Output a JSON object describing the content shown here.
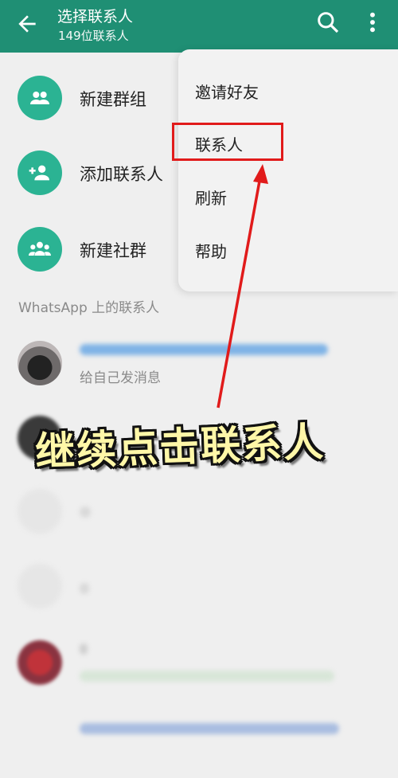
{
  "header": {
    "title": "选择联系人",
    "subtitle": "149位联系人"
  },
  "actions": [
    {
      "label": "新建群组",
      "icon": "group-icon"
    },
    {
      "label": "添加联系人",
      "icon": "add-person-icon"
    },
    {
      "label": "新建社群",
      "icon": "community-icon"
    }
  ],
  "section": {
    "label": "WhatsApp 上的联系人"
  },
  "contacts": [
    {
      "status": "给自己发消息"
    }
  ],
  "menu": {
    "items": [
      "邀请好友",
      "联系人",
      "刷新",
      "帮助"
    ],
    "highlighted_index": 1
  },
  "overlay": {
    "caption": "继续点击联系人"
  },
  "colors": {
    "header": "#1f8f74",
    "accent": "#2bb393",
    "highlight": "#e11b1b"
  }
}
